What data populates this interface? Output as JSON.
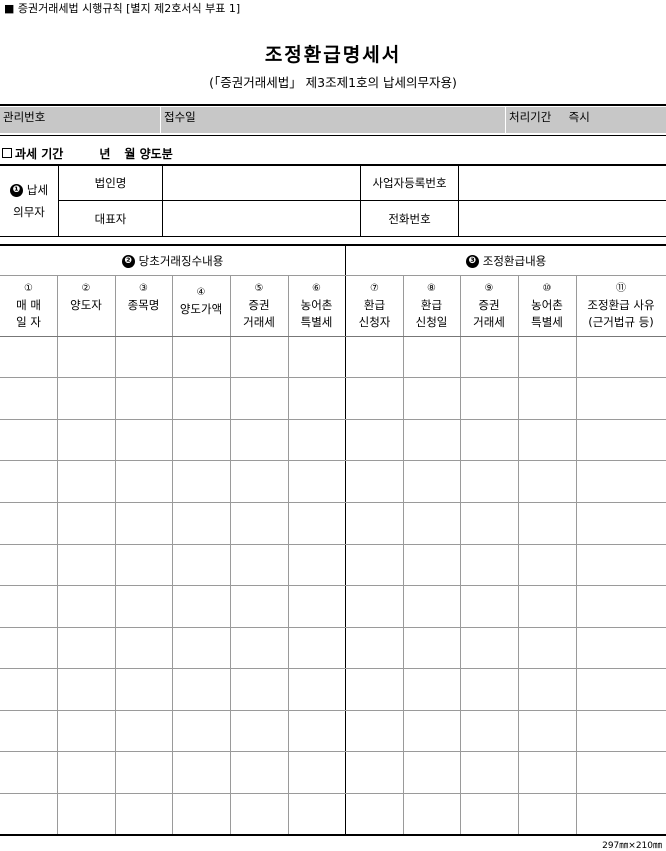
{
  "header_note": "■ 증권거래세법 시행규칙 [별지 제2호서식 부표 1]",
  "title": "조정환급명세서",
  "subtitle": "(「증권거래세법」 제3조제1호의 납세의무자용)",
  "admin": {
    "mgmt_no": "관리번호",
    "receipt_date": "접수일",
    "processing_period": "처리기간",
    "processing_value": "즉시"
  },
  "period": {
    "label": "과세 기간",
    "year": "년",
    "month": "월",
    "suffix": "양도분"
  },
  "taxpayer": {
    "section_num": "❶",
    "section_label_1": "납세",
    "section_label_2": "의무자",
    "corp_name": "법인명",
    "biz_reg_no": "사업자등록번호",
    "representative": "대표자",
    "phone": "전화번호"
  },
  "sections": {
    "original": {
      "num": "❷",
      "label": "당초거래징수내용"
    },
    "adjusted": {
      "num": "❸",
      "label": "조정환급내용"
    }
  },
  "columns": [
    {
      "num": "①",
      "line1": "매 매",
      "line2": "일 자"
    },
    {
      "num": "②",
      "line1": "양도자",
      "line2": ""
    },
    {
      "num": "③",
      "line1": "종목명",
      "line2": ""
    },
    {
      "num": "④",
      "line1": "양도가액",
      "line2": ""
    },
    {
      "num": "⑤",
      "line1": "증권",
      "line2": "거래세"
    },
    {
      "num": "⑥",
      "line1": "농어촌",
      "line2": "특별세"
    },
    {
      "num": "⑦",
      "line1": "환급",
      "line2": "신청자"
    },
    {
      "num": "⑧",
      "line1": "환급",
      "line2": "신청일"
    },
    {
      "num": "⑨",
      "line1": "증권",
      "line2": "거래세"
    },
    {
      "num": "⑩",
      "line1": "농어촌",
      "line2": "특별세"
    },
    {
      "num": "⑪",
      "line1": "조정환급 사유",
      "line2": "(근거법규 등)"
    }
  ],
  "footer": "297㎜×210㎜"
}
